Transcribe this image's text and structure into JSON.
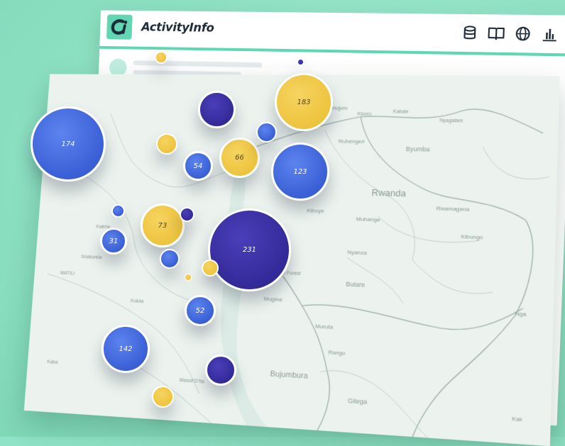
{
  "app": {
    "title": "ActivityInfo",
    "logo_text": "Ci",
    "header_icons": [
      "database-icon",
      "book-icon",
      "globe-icon",
      "bar-chart-icon"
    ]
  },
  "map": {
    "labels": {
      "rwanda": "Rwanda",
      "byumba": "Byumba",
      "ruhengeri": "Ruhengeri",
      "kisoro": "Kisoro",
      "kabale": "Kabale",
      "nyagatare": "Nyagatare",
      "rubuguru": "Rubuguru",
      "rwamagana": "Rwamagana",
      "kibungo": "Kibungo",
      "muhanga": "Muhanga",
      "nyanza": "Nyanza",
      "butare": "Butare",
      "kibuye": "Kibuye",
      "nyungwe": "Nyungwe Forest",
      "mugina": "Mugina",
      "muruta": "Muruta",
      "rango": "Rango",
      "bujumbura": "Bujumbura",
      "gitega": "Gitega",
      "kalehe": "Kalehe",
      "shabunda": "Shabunda",
      "matili": "MATILI",
      "kolula": "Kolula",
      "massif": "Massif D'Ita",
      "nga": "Nga",
      "kak": "Kak",
      "kaba": "Kaba"
    }
  },
  "bubbles": [
    {
      "value": "174",
      "color": "blue"
    },
    {
      "value": "183",
      "color": "yellow"
    },
    {
      "value": "66",
      "color": "yellow"
    },
    {
      "value": "54",
      "color": "blue"
    },
    {
      "value": "123",
      "color": "blue"
    },
    {
      "value": "73",
      "color": "yellow"
    },
    {
      "value": "31",
      "color": "blue"
    },
    {
      "value": "231",
      "color": "navy"
    },
    {
      "value": "52",
      "color": "blue"
    },
    {
      "value": "142",
      "color": "blue"
    }
  ],
  "colors": {
    "accent": "#5ed7b5",
    "blue": "#3a5fd6",
    "navy": "#332a99",
    "yellow": "#eec43e",
    "background": "#8fe3c6"
  }
}
